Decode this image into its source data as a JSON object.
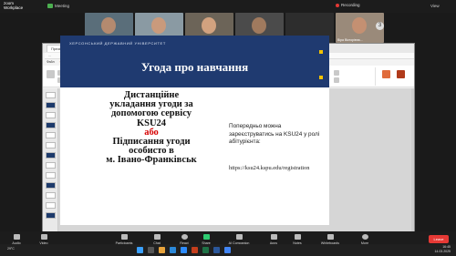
{
  "zoom": {
    "brand_top": "zoom",
    "brand_sub": "Workplace",
    "meeting_label": "Meeting",
    "recording_label": "Recording",
    "view_label": "View"
  },
  "participants": [
    {
      "name": "Юрій Юрійович Юрій..."
    },
    {
      "name": "Юрій Юрійович Юрій..."
    },
    {
      "name": "Анастасія Вікторівна"
    },
    {
      "name": "Ірина Вікторівна"
    },
    {
      "name": "ЗДО №85 Антоніна..."
    },
    {
      "name": "Віра Вікторівна..."
    }
  ],
  "thumbs_next": "3",
  "ppt": {
    "tab_active": "Презентація1",
    "tab_other": "2",
    "address": "...",
    "ribbon_tabs": [
      "Файл",
      "Основне",
      "Вставлення",
      "Конструктор",
      "Переходи",
      "Анімація",
      "Показ слайдів",
      "Запис",
      "Рецензування",
      "Вигляд",
      "Довідка"
    ]
  },
  "slide": {
    "university": "ХЕРСОНСЬКИЙ ДЕРЖАВНИЙ УНІВЕРСИТЕТ",
    "title": "Угода про навчання",
    "left_line1": "Дистанційне",
    "left_line2": "укладання угоди за",
    "left_line3": "допомогою сервісу",
    "left_line4": "KSU24",
    "left_or": "або",
    "left_line5": "Підписання угоди",
    "left_line6": "особисто в",
    "left_line7": "м. Івано-Франківськ",
    "right_line1": "Попередньо можна",
    "right_line2": "зареєструватись на KSU24 у ролі",
    "right_line3": "абітурієнта:",
    "url": "https://ksu24.kspu.edu/registration"
  },
  "toolbar": {
    "audio": "Audio",
    "video": "Video",
    "participants": "Participants",
    "participants_count": "17",
    "chat": "Chat",
    "react": "React",
    "share": "Share",
    "ai_companion": "AI Companion",
    "apps": "Apps",
    "notes": "Notes",
    "whiteboards": "Whiteboards",
    "more": "More",
    "leave": "Leave"
  },
  "taskbar": {
    "weather": "29°C",
    "time": "16:45",
    "date": "14.03.2025"
  },
  "colors": {
    "slide_blue": "#1f3a70",
    "accent_gold": "#f2c200",
    "alert_red": "#d50000"
  }
}
